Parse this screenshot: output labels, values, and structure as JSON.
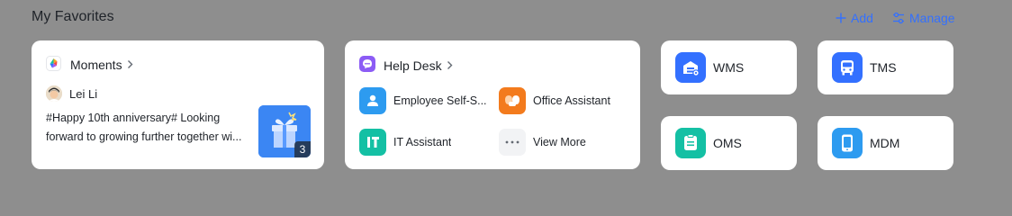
{
  "section": {
    "title": "My Favorites",
    "add_label": "Add",
    "manage_label": "Manage"
  },
  "moments": {
    "title": "Moments",
    "author": "Lei Li",
    "post_line1": "#Happy 10th anniversary# Looking",
    "post_line2": "forward to growing further together wi...",
    "image_count": "3"
  },
  "help_desk": {
    "title": "Help Desk",
    "items": [
      {
        "label": "Employee Self-S...",
        "icon": "person-icon",
        "color": "#2d9bf0"
      },
      {
        "label": "Office Assistant",
        "icon": "office-assistant-icon",
        "color": "#f37b1d"
      },
      {
        "label": "IT Assistant",
        "icon": "it-icon",
        "color": "#14c0a4"
      },
      {
        "label": "View More",
        "icon": "more-icon",
        "color": "#f2f3f5"
      }
    ]
  },
  "apps": [
    {
      "label": "WMS",
      "icon": "warehouse-icon",
      "color": "#3370ff"
    },
    {
      "label": "TMS",
      "icon": "bus-icon",
      "color": "#3370ff"
    },
    {
      "label": "OMS",
      "icon": "document-icon",
      "color": "#14c0a4"
    },
    {
      "label": "MDM",
      "icon": "tablet-icon",
      "color": "#2d9bf0"
    }
  ],
  "colors": {
    "accent": "#3370ff",
    "background": "#8e8e8e",
    "card": "#ffffff",
    "text": "#1f2329"
  }
}
